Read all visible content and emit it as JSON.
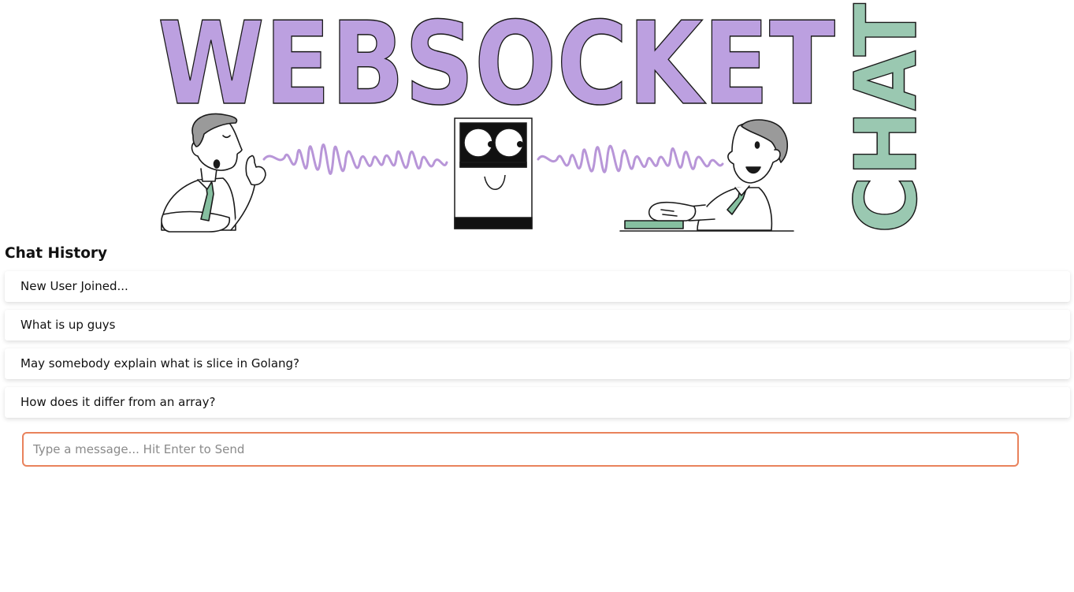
{
  "banner": {
    "word_main": "WEBSOCKET",
    "word_side": "CHAT",
    "icons": [
      "speaking-man-icon",
      "sound-wave-icon",
      "websocket-robot-icon",
      "typing-man-icon"
    ]
  },
  "colors": {
    "banner_purple": "#bca0e0",
    "banner_green": "#9ac8b1",
    "wave_purple": "#b896d8",
    "tie_green": "#86bfa0",
    "input_border": "#e9825c"
  },
  "chat": {
    "title": "Chat History",
    "messages": [
      {
        "text": "New User Joined..."
      },
      {
        "text": "What is up guys"
      },
      {
        "text": "May somebody explain what is slice in Golang?"
      },
      {
        "text": "How does it differ from an array?"
      }
    ]
  },
  "composer": {
    "placeholder": "Type a message... Hit Enter to Send",
    "value": ""
  }
}
